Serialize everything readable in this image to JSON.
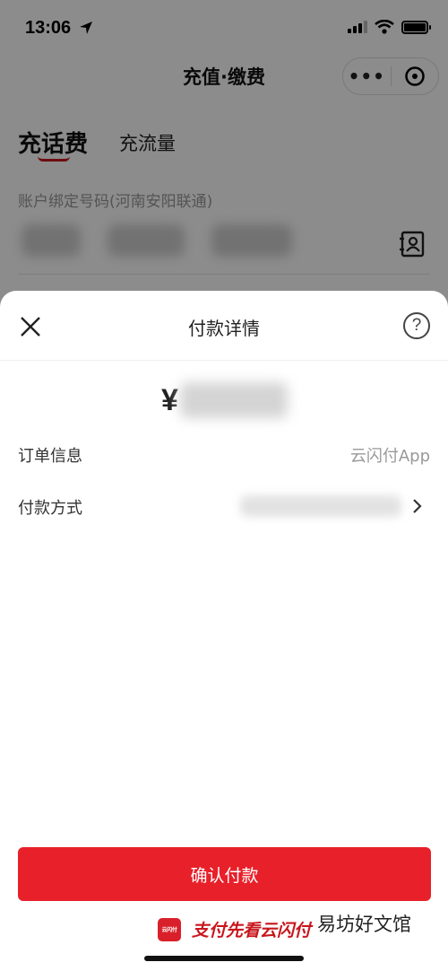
{
  "status_bar": {
    "time": "13:06"
  },
  "nav": {
    "title": "充值·缴费",
    "more_label": "•••"
  },
  "tabs": [
    {
      "label": "充话费",
      "active": true
    },
    {
      "label": "充流量",
      "active": false
    }
  ],
  "account": {
    "label": "账户绑定号码(河南安阳联通)"
  },
  "sheet": {
    "title": "付款详情",
    "help": "?",
    "currency_symbol": "¥",
    "rows": [
      {
        "label": "订单信息",
        "value": "云闪付App"
      },
      {
        "label": "付款方式",
        "value": ""
      }
    ],
    "confirm_label": "确认付款",
    "brand_logo_text": "云闪付",
    "brand_slogan": "支付先看云闪付"
  },
  "watermark": "易坊好文馆",
  "colors": {
    "accent": "#e8202a",
    "tab_underline": "#c8161d"
  }
}
